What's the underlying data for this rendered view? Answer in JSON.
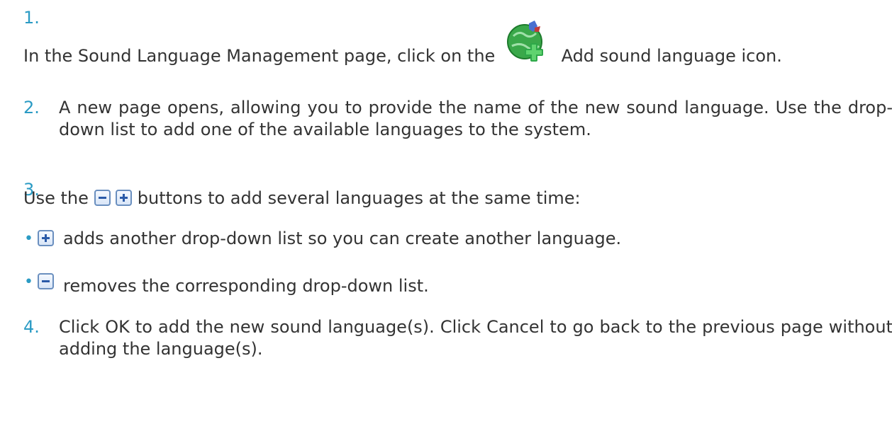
{
  "steps": [
    {
      "number": "1.",
      "before": "In the Sound Language Management page, click on the",
      "after": "Add sound language icon.",
      "icon": "add-sound-language-icon"
    },
    {
      "number": "2.",
      "text": "A new page opens, allowing you to provide the name of the new sound language. Use the drop-down list to add one of the available languages to the system."
    },
    {
      "number": "3.",
      "before": "Use the",
      "after": "buttons to add several languages at the same time:",
      "icons": [
        "minus-button-icon",
        "plus-button-icon"
      ],
      "bullets": [
        {
          "icon": "plus-button-icon",
          "text": "adds another drop-down list so you can create another language."
        },
        {
          "icon": "minus-button-icon",
          "text": "removes the corresponding drop-down list."
        }
      ]
    },
    {
      "number": "4.",
      "text": "Click OK to add the new sound language(s). Click Cancel to go back to the previous page without adding the language(s)."
    }
  ],
  "colors": {
    "number": "#2b9bc4",
    "text": "#333333"
  }
}
